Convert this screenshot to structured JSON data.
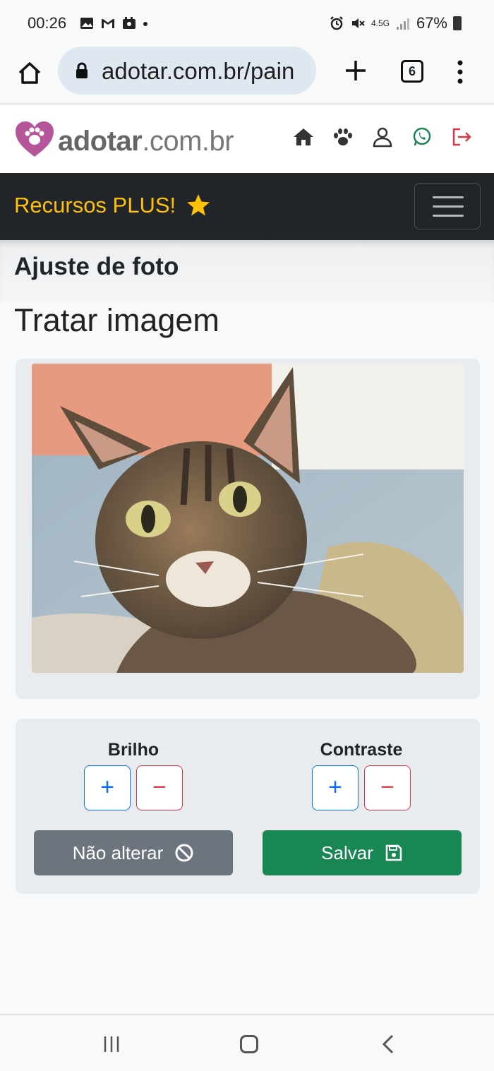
{
  "status_bar": {
    "time": "00:26",
    "network": "4.5G",
    "battery": "67%"
  },
  "browser": {
    "url": "adotar.com.br/pain",
    "tab_count": "6"
  },
  "site": {
    "logo_bold": "adotar",
    "logo_rest": ".com.br",
    "header_icons": [
      "home-icon",
      "paw-icon",
      "user-icon",
      "whatsapp-icon",
      "logout-icon"
    ]
  },
  "navbar": {
    "title": "Recursos PLUS!"
  },
  "section": {
    "title": "Ajuste de foto"
  },
  "page": {
    "heading": "Tratar imagem"
  },
  "controls": {
    "brightness_label": "Brilho",
    "contrast_label": "Contraste",
    "plus_symbol": "+",
    "minus_symbol": "−",
    "cancel_label": "Não alterar",
    "save_label": "Salvar"
  },
  "colors": {
    "navbar_bg": "#212529",
    "accent_yellow": "#ffc107",
    "primary_blue": "#0d6efd",
    "danger_red": "#dc3545",
    "success_green": "#198754",
    "secondary_gray": "#6c757d",
    "logo_pink": "#b5569a"
  }
}
